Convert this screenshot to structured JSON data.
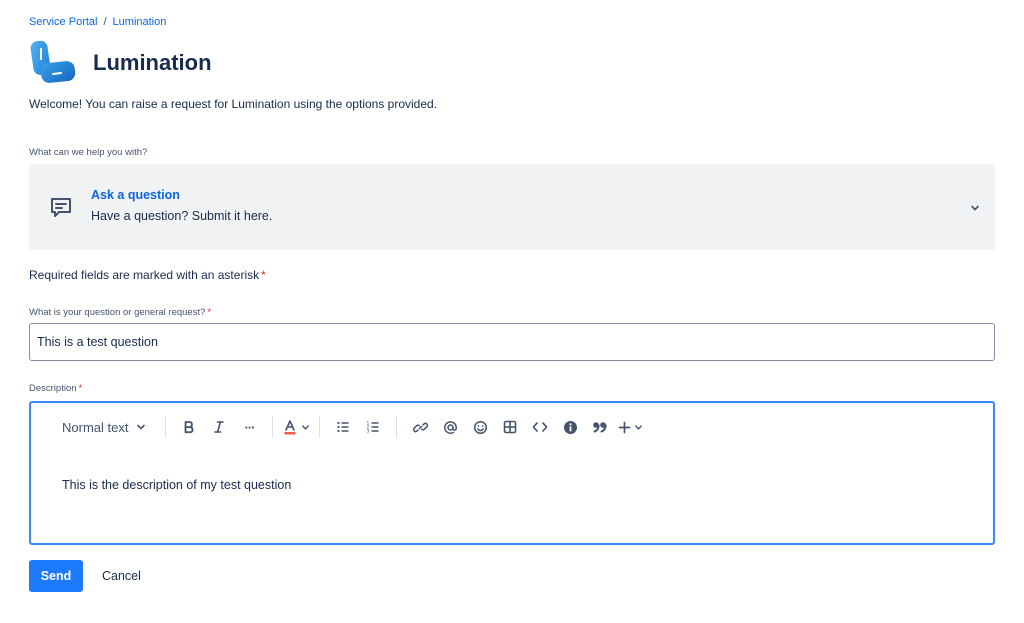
{
  "breadcrumb": {
    "items": [
      "Service Portal",
      "Lumination"
    ],
    "separator": "/"
  },
  "header": {
    "title": "Lumination",
    "logo_icon": "lumination-logo"
  },
  "welcome": "Welcome! You can raise a request for Lumination using the options provided.",
  "request_type": {
    "label": "What can we help you with?",
    "icon": "chat-icon",
    "title": "Ask a question",
    "description": "Have a question? Submit it here."
  },
  "required_note": {
    "text": "Required fields are marked with an asterisk",
    "star": "*"
  },
  "question_field": {
    "label": "What is your question or general request?",
    "star": "*",
    "value": "This is a test question"
  },
  "description_field": {
    "label": "Description",
    "star": "*",
    "toolbar": {
      "text_style": "Normal text",
      "more": "···"
    },
    "content": "This is the description of my test question"
  },
  "actions": {
    "send": "Send",
    "cancel": "Cancel"
  },
  "colors": {
    "accent": "#1d7afc",
    "link": "#0c66e4",
    "required": "#c9372c",
    "card_bg": "#f1f2f4",
    "focus_border": "#388bff"
  }
}
